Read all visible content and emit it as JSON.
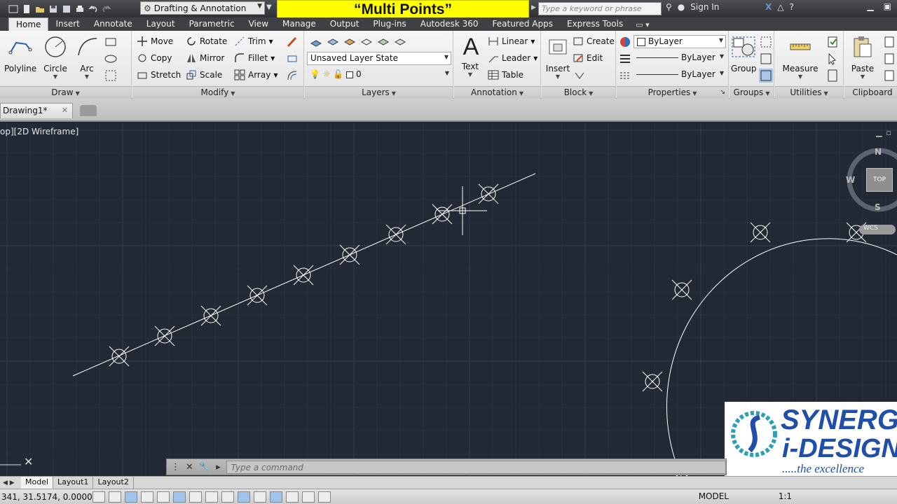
{
  "titlebar": {
    "workspace": "Drafting & Annotation",
    "banner": "“Multi Points”",
    "search_placeholder": "Type a keyword or phrase",
    "sign_in": "Sign In"
  },
  "ribbon_tabs": [
    "Home",
    "Insert",
    "Annotate",
    "Layout",
    "Parametric",
    "View",
    "Manage",
    "Output",
    "Plug-ins",
    "Autodesk 360",
    "Featured Apps",
    "Express Tools"
  ],
  "panels": {
    "draw": {
      "title": "Draw",
      "polyline": "Polyline",
      "circle": "Circle",
      "arc": "Arc"
    },
    "modify": {
      "title": "Modify",
      "move": "Move",
      "rotate": "Rotate",
      "trim": "Trim",
      "copy": "Copy",
      "mirror": "Mirror",
      "fillet": "Fillet",
      "stretch": "Stretch",
      "scale": "Scale",
      "array": "Array"
    },
    "layers": {
      "title": "Layers",
      "layer_state": "Unsaved Layer State",
      "current_layer": "0"
    },
    "annotation": {
      "title": "Annotation",
      "text": "Text",
      "linear": "Linear",
      "leader": "Leader",
      "table": "Table"
    },
    "block": {
      "title": "Block",
      "insert": "Insert",
      "create": "Create",
      "edit": "Edit"
    },
    "properties": {
      "title": "Properties",
      "color": "ByLayer",
      "lineweight": "ByLayer",
      "linetype": "ByLayer"
    },
    "groups": {
      "title": "Groups",
      "group": "Group"
    },
    "utilities": {
      "title": "Utilities",
      "measure": "Measure"
    },
    "clipboard": {
      "title": "Clipboard",
      "paste": "Paste"
    }
  },
  "document_tab": "Drawing1*",
  "viewport_label": "op][2D Wireframe]",
  "viewcube": {
    "top": "TOP",
    "north": "N",
    "south": "S",
    "west": "W",
    "wcs": "WCS"
  },
  "command": {
    "placeholder": "Type  a  command"
  },
  "layout_tabs": [
    "Model",
    "Layout1",
    "Layout2"
  ],
  "status": {
    "coords": "341, 31.5174, 0.0000",
    "mode": "MODEL",
    "scale": "1:1"
  },
  "logo": {
    "line1": "SYNERGY",
    "line2": "i-DESIGN",
    "line3": ".....the excellence"
  },
  "colors": {
    "canvas": "#222935",
    "grid_minor": "#2a3140",
    "grid_major": "#343c4c",
    "entity": "#ffffff",
    "banner": "#ffff00"
  }
}
